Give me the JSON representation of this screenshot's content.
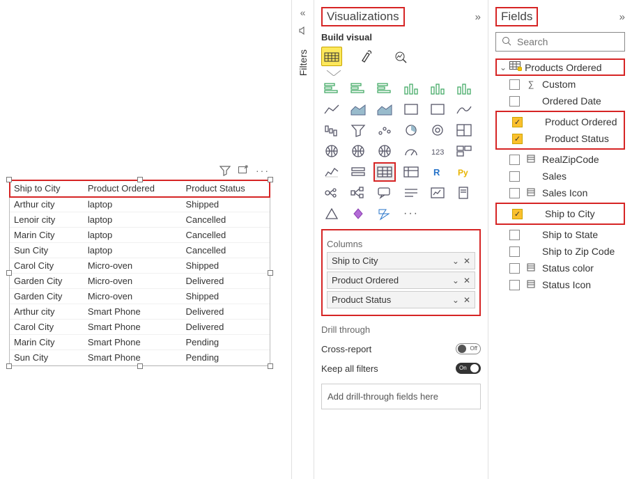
{
  "filters_rail": {
    "label": "Filters"
  },
  "viz_panel": {
    "title": "Visualizations",
    "build_label": "Build visual",
    "columns_label": "Columns",
    "columns": [
      {
        "label": "Ship to City"
      },
      {
        "label": "Product Ordered"
      },
      {
        "label": "Product Status"
      }
    ],
    "drill_label": "Drill through",
    "cross_report_label": "Cross-report",
    "cross_report_state": "Off",
    "keep_filters_label": "Keep all filters",
    "keep_filters_state": "On",
    "drill_placeholder": "Add drill-through fields here"
  },
  "fields_panel": {
    "title": "Fields",
    "search_placeholder": "Search",
    "table_name": "Products Ordered",
    "fields": [
      {
        "label": "Custom",
        "checked": false,
        "type": "sigma"
      },
      {
        "label": "Ordered Date",
        "checked": false,
        "type": ""
      },
      {
        "label": "Product Ordered",
        "checked": true,
        "type": ""
      },
      {
        "label": "Product Status",
        "checked": true,
        "type": ""
      },
      {
        "label": "RealZipCode",
        "checked": false,
        "type": "calc"
      },
      {
        "label": "Sales",
        "checked": false,
        "type": ""
      },
      {
        "label": "Sales Icon",
        "checked": false,
        "type": "calc"
      },
      {
        "label": "Ship to City",
        "checked": true,
        "type": ""
      },
      {
        "label": "Ship to State",
        "checked": false,
        "type": ""
      },
      {
        "label": "Ship to Zip Code",
        "checked": false,
        "type": ""
      },
      {
        "label": "Status color",
        "checked": false,
        "type": "calc"
      },
      {
        "label": "Status Icon",
        "checked": false,
        "type": "calc"
      }
    ]
  },
  "table_visual": {
    "headers": [
      "Ship to City",
      "Product Ordered",
      "Product Status"
    ],
    "rows": [
      [
        "Arthur city",
        "laptop",
        "Shipped"
      ],
      [
        "Lenoir city",
        "laptop",
        "Cancelled"
      ],
      [
        "Marin City",
        "laptop",
        "Cancelled"
      ],
      [
        "Sun City",
        "laptop",
        "Cancelled"
      ],
      [
        "Carol City",
        "Micro-oven",
        "Shipped"
      ],
      [
        "Garden City",
        "Micro-oven",
        "Delivered"
      ],
      [
        "Garden City",
        "Micro-oven",
        "Shipped"
      ],
      [
        "Arthur city",
        "Smart Phone",
        "Delivered"
      ],
      [
        "Carol City",
        "Smart Phone",
        "Delivered"
      ],
      [
        "Marin City",
        "Smart Phone",
        "Pending"
      ],
      [
        "Sun City",
        "Smart Phone",
        "Pending"
      ]
    ]
  }
}
